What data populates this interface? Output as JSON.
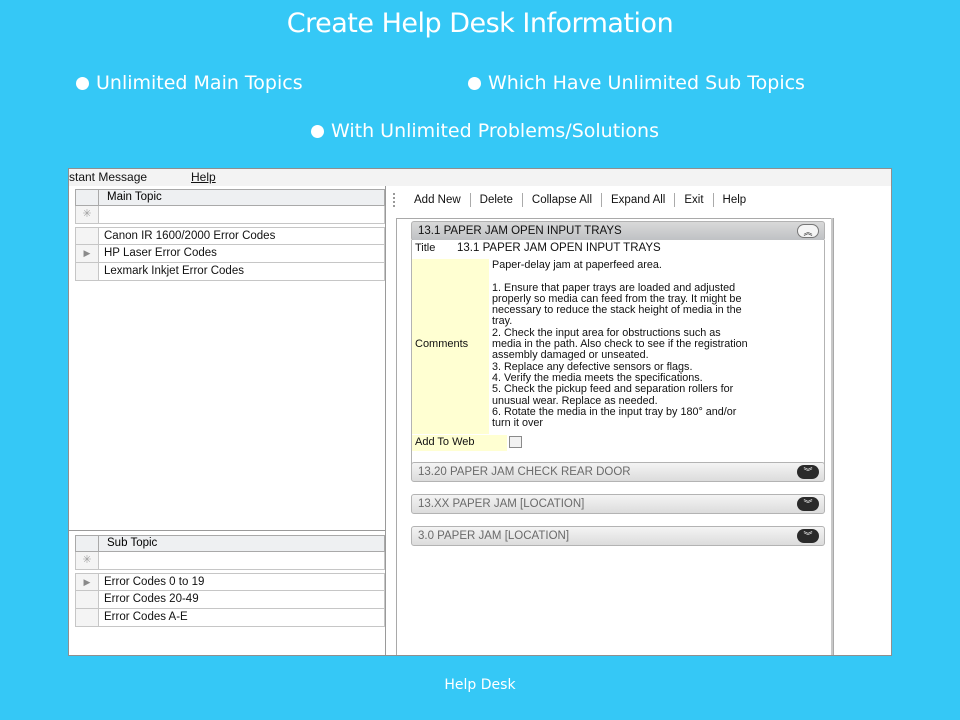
{
  "slide": {
    "title": "Create Help Desk Information",
    "bullets": [
      "Unlimited Main Topics",
      "Which Have Unlimited Sub Topics",
      "With Unlimited Problems/Solutions"
    ],
    "footer": "Help Desk",
    "background_color": "#35c8f6"
  },
  "app": {
    "menu": [
      "stant Message",
      "Help"
    ],
    "main_topic": {
      "header": "Main Topic",
      "rows": [
        "Canon IR 1600/2000 Error Codes",
        "HP Laser Error Codes",
        "Lexmark Inkjet Error Codes"
      ]
    },
    "sub_topic": {
      "header": "Sub Topic",
      "rows": [
        "Error Codes 0 to 19",
        "Error Codes 20-49",
        "Error Codes A-E"
      ]
    },
    "toolbar": [
      "Add New",
      "Delete",
      "Collapse All",
      "Expand All",
      "Exit",
      "Help"
    ],
    "panels": [
      {
        "header": "13.1 PAPER JAM OPEN INPUT TRAYS",
        "expanded": true,
        "title_label": "Title",
        "title_value": "13.1 PAPER JAM OPEN INPUT TRAYS",
        "comments_label": "Comments",
        "comments": [
          "Paper-delay jam at paperfeed area.",
          "",
          "1. Ensure that paper trays are loaded and adjusted",
          "properly so media can feed from the tray. It might be",
          "necessary to reduce the stack height of media in the",
          "tray.",
          "2. Check the input area for obstructions such as",
          "media in the path. Also check to see if the registration",
          "assembly damaged or unseated.",
          "3. Replace any defective sensors or flags.",
          "4. Verify the media meets the specifications.",
          "5. Check the pickup feed and separation rollers for",
          "unusual wear. Replace as needed.",
          "6. Rotate the media in the input tray by 180° and/or",
          "turn it over"
        ],
        "web_label": "Add To Web",
        "add_to_web": false
      },
      {
        "header": "13.20 PAPER JAM CHECK REAR DOOR",
        "expanded": false
      },
      {
        "header": "13.XX PAPER JAM [LOCATION]",
        "expanded": false
      },
      {
        "header": "3.0 PAPER JAM [LOCATION]",
        "expanded": false
      }
    ],
    "icons": {
      "row_indicator": "triangle-right-icon",
      "new_row": "asterisk-icon",
      "collapse": "chevron-up-double-icon",
      "expand": "chevron-down-double-icon"
    }
  }
}
